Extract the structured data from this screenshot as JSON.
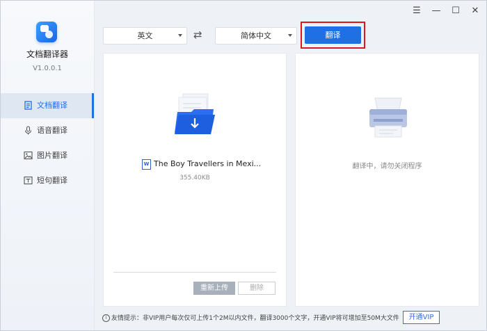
{
  "app": {
    "name": "文档翻译器",
    "version": "V1.0.0.1"
  },
  "window_controls": {
    "menu": "☰",
    "minimize": "—",
    "maximize": "☐",
    "close": "✕"
  },
  "sidebar": {
    "items": [
      {
        "label": "文档翻译",
        "icon": "document-icon",
        "active": true
      },
      {
        "label": "语音翻译",
        "icon": "microphone-icon",
        "active": false
      },
      {
        "label": "图片翻译",
        "icon": "image-icon",
        "active": false
      },
      {
        "label": "短句翻译",
        "icon": "text-icon",
        "active": false
      }
    ]
  },
  "toolbar": {
    "source_lang": "英文",
    "swap_icon": "⇄",
    "target_lang": "简体中文",
    "translate_label": "翻译"
  },
  "file": {
    "name": "The Boy Travellers in Mexi...",
    "size": "355.40KB",
    "type_badge": "W"
  },
  "actions": {
    "reupload_label": "重新上传",
    "delete_label": "删除"
  },
  "result": {
    "status": "翻译中，请勿关闭程序"
  },
  "footer": {
    "tip": "友情提示：非VIP用户每次仅可上传1个2M以内文件，翻译3000个文字，开通VIP将可增加至50M大文件",
    "vip_label": "开通VIP"
  },
  "colors": {
    "accent": "#1f6fe5",
    "highlight_frame": "#e0141e"
  }
}
